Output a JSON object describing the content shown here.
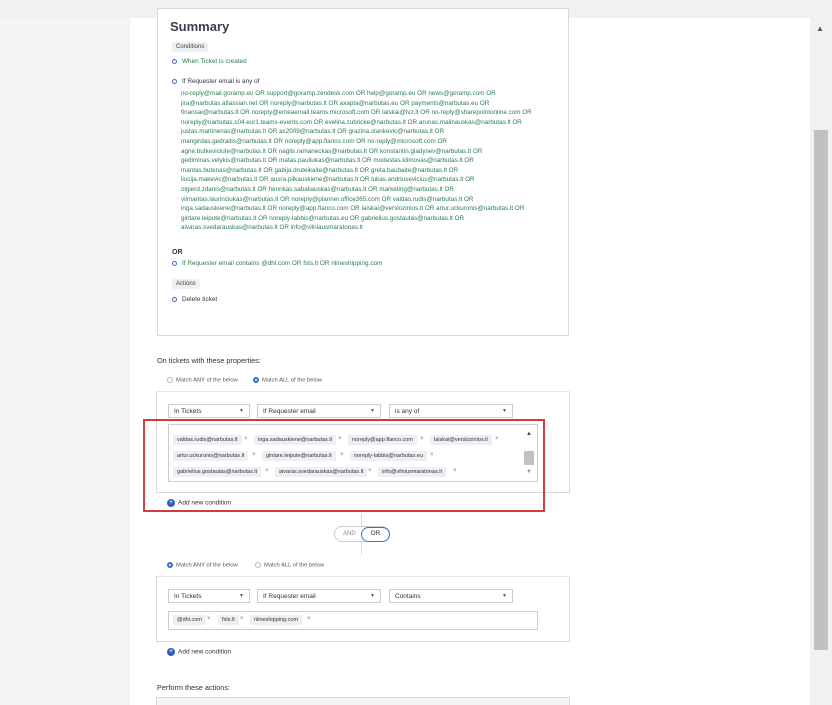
{
  "summary": {
    "title": "Summary",
    "conditions_tag": "Conditions",
    "when": "When Ticket is created",
    "if_email": "If Requester email is any of",
    "email_lines": [
      "no-reply@mail.goramp.eu OR support@goramp.zendesk.com OR help@goramp.eu OR news@goramp.com OR",
      "jira@narbutas.atlassian.net OR noreply@narbutas.lt OR axapta@narbutas.eu OR payments@narbutas.eu OR",
      "finansai@narbutas.lt OR noreply@emeaemail.teams.microsoft.com OR laiskai@lvz.lt OR no-reply@sharepointonline.com OR",
      "noreply@narbutas.s04.eur1.teams-events.com OR evelina.zubricke@narbutas.lt OR arunas.malinauskas@narbutas.lt OR",
      "justas.martinenas@narbutas.lt OR ax2009@narbutas.lt OR grazina.stankevic@narbutas.lt OR",
      "mangirdas.gedraitis@narbutas.lt OR noreply@app.flanco.com OR no-reply@microsoft.com OR",
      "agne.butkeviciute@narbutas.lt OR naglis.ramaneckas@narbutas.lt OR konstantin.gladysev@narbutas.lt OR",
      "gediminas.velykis@narbutas.lt OR matas.pauliukas@narbutas.lt OR modestas.klimovas@narbutas.lt OR",
      "mantas.butenas@narbutas.lt OR gabija.druteikaite@narbutas.lt OR greta.baubaite@narbutas.lt OR",
      "liucija.makevic@narbutas.lt OR ausra.pilkauskiene@narbutas.lt OR lukas.andriusevicius@narbutas.lt OR",
      "olgierd.zdanis@narbutas.lt OR henrikas.sabaliauskas@narbutas.lt OR marketing@narbutas.lt OR",
      "vilmantas.laurinciukas@narbutas.lt OR noreply@planner.office365.com OR valdas.rudis@narbutas.lt OR",
      "inga.sadauskiene@narbutas.lt OR noreply@app.flanco.com OR laiskai@verslozinios.lt OR artur.uckuronis@narbutas.lt OR",
      "gintare.leipute@narbutas.lt OR noreply-labbis@narbutas.eu OR gabrielius.gostautas@narbutas.lt OR",
      "aivaras.svedarauskas@narbutas.lt OR info@vilniausmaratonas.lt"
    ],
    "or_label": "OR",
    "if_contains": "If Requester email contains @dhl.com OR fsts.lt OR nlineshipping.com",
    "actions_tag": "Actions",
    "delete": "Delete ticket"
  },
  "props_title": "On tickets with these properties:",
  "group1": {
    "match_any": "Match ANY of the below",
    "match_all": "Match ALL of the below",
    "selected": "all",
    "sel1": "In Tickets",
    "sel2": "If Requester email",
    "sel3": "is any of",
    "chips": [
      [
        "valdas.rudis@narbutas.lt",
        "inga.sadauskiene@narbutas.lt",
        "noreply@app.flanco.com",
        "laiskai@verslozinios.lt"
      ],
      [
        "artur.uckuronis@narbutas.lt",
        "gintare.leipute@narbutas.lt",
        "noreply-labbis@narbutas.eu"
      ],
      [
        "gabrielius.gostautas@narbutas.lt",
        "aivaras.svedarauskas@narbutas.lt",
        "info@vilniusmaratonas.lt"
      ]
    ],
    "add_condition": "Add new condition"
  },
  "toggle": {
    "and": "AND",
    "or": "OR",
    "selected": "OR"
  },
  "group2": {
    "match_any": "Match ANY of the below",
    "match_all": "Match ALL of the below",
    "selected": "any",
    "sel1": "In Tickets",
    "sel2": "If Requester email",
    "sel3": "Contains",
    "chips": [
      "@dhl.com",
      "fsts.lt",
      "nlineshipping.com"
    ],
    "add_condition": "Add new condition"
  },
  "actions_title": "Perform these actions:"
}
